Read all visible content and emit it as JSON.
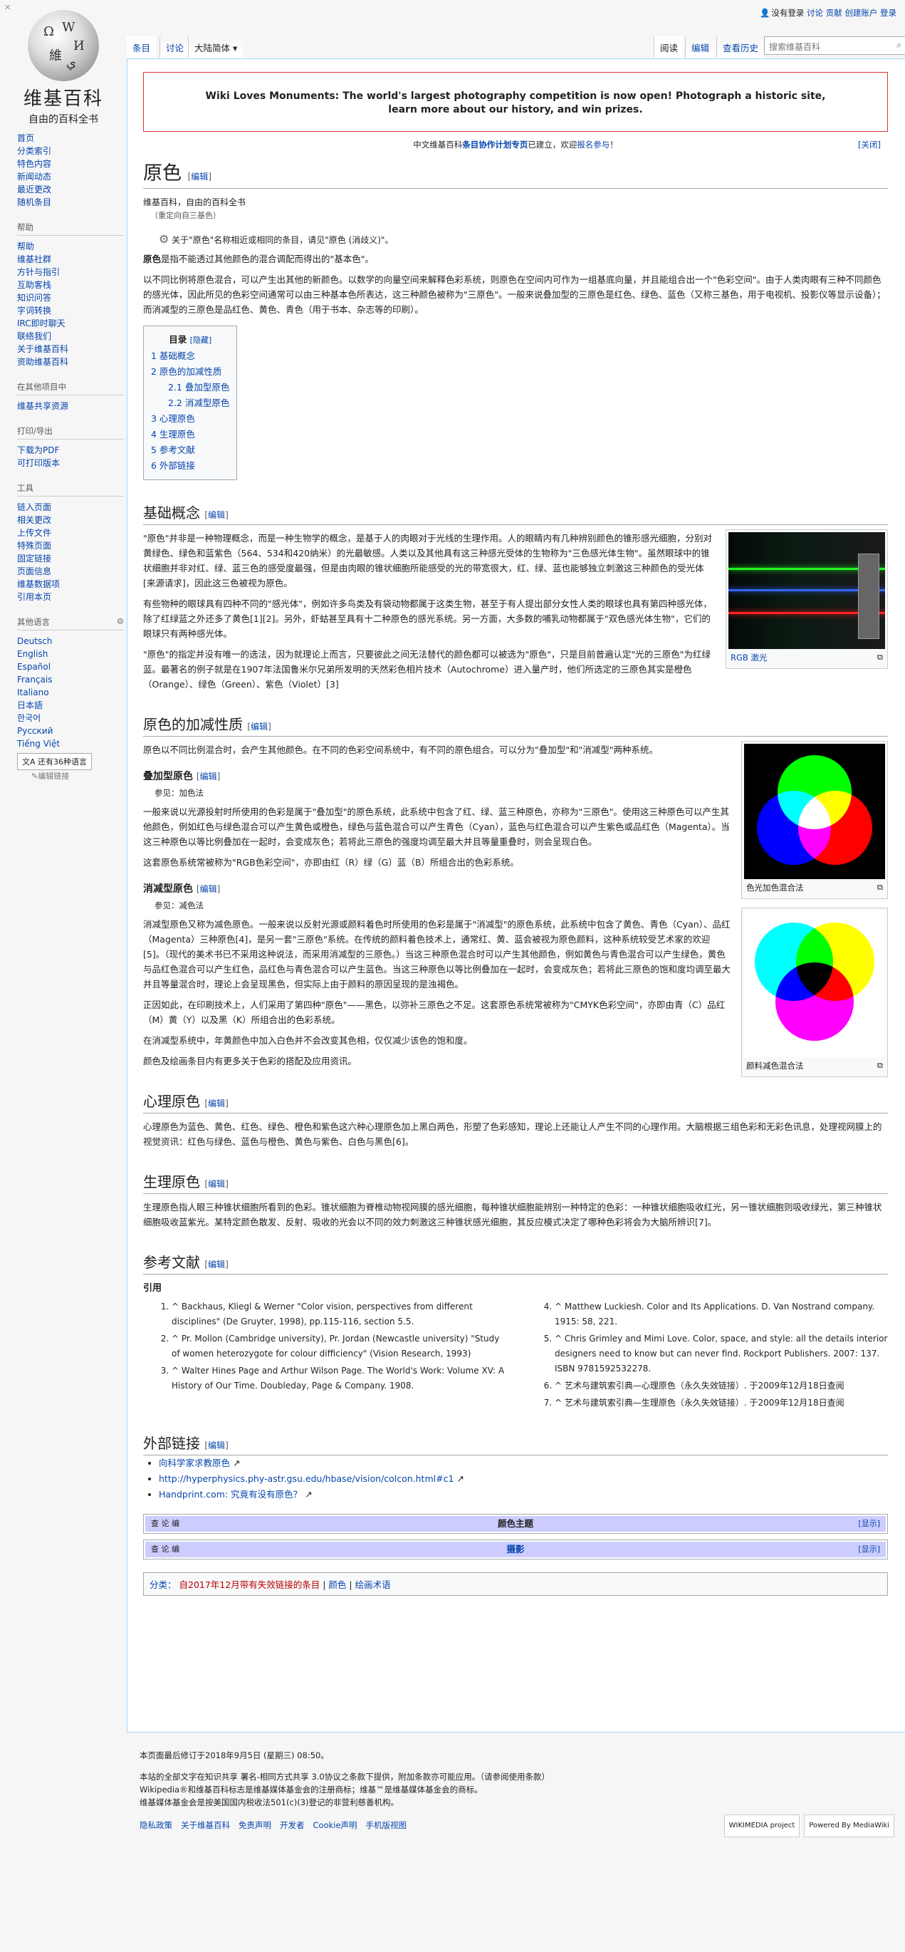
{
  "personal": {
    "notlogged": "没有登录",
    "talk": "讨论",
    "contrib": "贡献",
    "create": "创建账户",
    "login": "登录"
  },
  "logo": {
    "title": "维基百科",
    "subtitle": "自由的百科全书"
  },
  "tabs": {
    "article": "条目",
    "talk": "讨论",
    "variant": "大陆简体",
    "read": "阅读",
    "edit": "编辑",
    "history": "查看历史",
    "search_placeholder": "搜索维基百科"
  },
  "sidebar": {
    "nav": [
      "首页",
      "分类索引",
      "特色内容",
      "新闻动态",
      "最近更改",
      "随机条目"
    ],
    "help_title": "帮助",
    "help": [
      "帮助",
      "维基社群",
      "方针与指引",
      "互助客栈",
      "知识问答",
      "字词转换",
      "IRC即时聊天",
      "联络我们",
      "关于维基百科",
      "资助维基百科"
    ],
    "other_title": "在其他项目中",
    "other": [
      "维基共享资源"
    ],
    "print_title": "打印/导出",
    "print": [
      "下载为PDF",
      "可打印版本"
    ],
    "tools_title": "工具",
    "tools": [
      "链入页面",
      "相关更改",
      "上传文件",
      "特殊页面",
      "固定链接",
      "页面信息",
      "维基数据项",
      "引用本页"
    ],
    "lang_title": "其他语言",
    "langs": [
      "Deutsch",
      "English",
      "Español",
      "Français",
      "Italiano",
      "日本語",
      "한국어",
      "Русский",
      "Tiếng Việt"
    ],
    "lang_btn": "还有36种语言",
    "edit_links": "编辑链接"
  },
  "banner": {
    "line1": "Wiki Loves Monuments: The world's largest photography competition is now open! Photograph a historic site,",
    "line2": "learn more about our history, and win prizes."
  },
  "cn_note": {
    "pre": "中文维基百科",
    "link1": "条目协作计划专页",
    "mid": "已建立，欢迎",
    "link2": "报名参与",
    "end": "！",
    "close": "[关闭]"
  },
  "title": "原色",
  "edit": "编辑",
  "siteSub": "维基百科，自由的百科全书",
  "redirect": "（重定向自三基色）",
  "hatnote": "关于\"原色\"名称相近或相同的条目，请见\"原色 (消歧义)\"。",
  "lead_bold": "原色",
  "lead1": "是指不能透过其他颜色的混合调配而得出的\"基本色\"。",
  "lead2": "以不同比例将原色混合，可以产生出其他的新颜色。以数学的向量空间来解释色彩系统，则原色在空间内可作为一组基底向量，并且能组合出一个\"色彩空间\"。由于人类肉眼有三种不同颜色的感光体，因此所见的色彩空间通常可以由三种基本色所表达，这三种颜色被称为\"三原色\"。一般来说叠加型的三原色是红色、绿色、蓝色（又称三基色，用于电视机、投影仪等显示设备）；而消减型的三原色是品红色、黄色、青色（用于书本、杂志等的印刷）。",
  "toc": {
    "title": "目录",
    "hide": "[隐藏]",
    "items": [
      "1 基础概念",
      "2 原色的加减性质",
      "2.1 叠加型原色",
      "2.2 消减型原色",
      "3 心理原色",
      "4 生理原色",
      "5 参考文献",
      "6 外部链接"
    ]
  },
  "s1": {
    "title": "基础概念",
    "p1": "\"原色\"并非是一种物理概念，而是一种生物学的概念，是基于人的肉眼对于光线的生理作用。人的眼睛内有几种辨别颜色的锥形感光细胞，分别对黄绿色、绿色和蓝紫色（564、534和420纳米）的光最敏感。人类以及其他具有这三种感光受体的生物称为\"三色感光体生物\"。虽然眼球中的锥状细胞并非对红、绿、蓝三色的感受度最强，但是由肉眼的锥状细胞所能感受的光的带宽很大，红、绿、蓝也能够独立刺激这三种颜色的受光体[来源请求]，因此这三色被视为原色。",
    "p2": "有些物种的眼球具有四种不同的\"感光体\"，例如许多鸟类及有袋动物都属于这类生物，甚至于有人提出部分女性人类的眼球也具有第四种感光体，除了红绿蓝之外还多了黄色[1][2]。另外，虾蛄甚至具有十二种原色的感光系统。另一方面，大多数的哺乳动物都属于\"双色感光体生物\"，它们的眼球只有两种感光体。",
    "p3": "\"原色\"的指定并没有唯一的选法，因为就理论上而言，只要彼此之间无法替代的颜色都可以被选为\"原色\"，只是目前普遍认定\"光的三原色\"为红绿蓝。最著名的例子就是在1907年法国鲁米尔兄弟所发明的天然彩色相片技术（Autochrome）进入量产时，他们所选定的三原色其实是橙色（Orange）、绿色（Green）、紫色（Violet）[3]",
    "cap": "RGB 激光"
  },
  "s2": {
    "title": "原色的加减性质",
    "p1": "原色以不同比例混合时，会产生其他颜色。在不同的色彩空间系统中，有不同的原色组合。可以分为\"叠加型\"和\"消减型\"两种系统。",
    "cap1": "色光加色混合法",
    "cap2": "颜料减色混合法"
  },
  "s21": {
    "title": "叠加型原色",
    "main": "参见：加色法",
    "p1": "一般来说以光源投射时所使用的色彩是属于\"叠加型\"的原色系统，此系统中包含了红、绿、蓝三种原色，亦称为\"三原色\"。使用这三种原色可以产生其他颜色，例如红色与绿色混合可以产生黄色或橙色，绿色与蓝色混合可以产生青色（Cyan），蓝色与红色混合可以产生紫色或品红色（Magenta）。当这三种原色以等比例叠加在一起时，会变成灰色；若将此三原色的强度均调至最大并且等量重叠时，则会呈现白色。",
    "p2": "这套原色系统常被称为\"RGB色彩空间\"，亦即由红（R）绿（G）蓝（B）所组合出的色彩系统。"
  },
  "s22": {
    "title": "消减型原色",
    "main": "参见：减色法",
    "p1": "消减型原色又称为减色原色。一般来说以反射光源或颜料着色时所使用的色彩是属于\"消减型\"的原色系统，此系统中包含了黄色、青色（Cyan）、品红（Magenta）三种原色[4]，是另一套\"三原色\"系统。在传统的颜料着色技术上，通常红、黄、蓝会被视为原色颜料，这种系统较受艺术家的欢迎[5]。（现代的美术书已不采用这种说法，而采用消减型的三原色。）当这三种原色混合时可以产生其他颜色，例如黄色与青色混合可以产生绿色，黄色与品红色混合可以产生红色，品红色与青色混合可以产生蓝色。当这三种原色以等比例叠加在一起时，会变成灰色；若将此三原色的饱和度均调至最大并且等量混合时，理论上会呈现黑色，但实际上由于颜料的原因呈现的是浊褐色。",
    "p2": "正因如此，在印刷技术上，人们采用了第四种\"原色\"——黑色，以弥补三原色之不足。这套原色系统常被称为\"CMYK色彩空间\"，亦即由青（C）品红（M）黄（Y）以及黑（K）所组合出的色彩系统。",
    "p3": "在消减型系统中，年黄颜色中加入白色并不会改变其色相，仅仅减少该色的饱和度。",
    "p4": "颜色及绘画条目内有更多关于色彩的搭配及应用资讯。"
  },
  "s3": {
    "title": "心理原色",
    "p1": "心理原色为蓝色、黄色、红色、绿色、橙色和紫色这六种心理原色加上黑白两色，形塑了色彩感知，理论上还能让人产生不同的心理作用。大脑根据三组色彩和无彩色讯息，处理视网膜上的视觉资讯：红色与绿色、蓝色与橙色、黄色与紫色、白色与黑色[6]。"
  },
  "s4": {
    "title": "生理原色",
    "p1": "生理原色指人眼三种锥状细胞所看到的色彩。锥状细胞为脊椎动物视网膜的感光细胞，每种锥状细胞能辨别一种特定的色彩：一种锥状细胞吸收红光，另一锥状细胞则吸收绿光，第三种锥状细胞吸收蓝紫光。某特定颜色散发、反射、吸收的光会以不同的效力刺激这三种锥状感光细胞，其反应模式决定了哪种色彩将会为大脑所辨识[7]。"
  },
  "s5": {
    "title": "参考文献",
    "sub": "引用",
    "refs": [
      "^ Backhaus, Kliegl & Werner \"Color vision, perspectives from different disciplines\" (De Gruyter, 1998), pp.115-116, section 5.5.",
      "^ Pr. Mollon (Cambridge university), Pr. Jordan (Newcastle university) \"Study of women heterozygote for colour difficiency\" (Vision Research, 1993)",
      "^ Walter Hines Page and Arthur Wilson Page. The World's Work: Volume XV: A History of Our Time. Doubleday, Page & Company. 1908.",
      "^ Matthew Luckiesh. Color and Its Applications. D. Van Nostrand company. 1915: 58, 221.",
      "^ Chris Grimley and Mimi Love. Color, space, and style: all the details interior designers need to know but can never find. Rockport Publishers. 2007: 137. ISBN 9781592532278.",
      "^ 艺术与建筑索引典—心理原色（永久失效链接）. 于2009年12月18日查阅",
      "^ 艺术与建筑索引典—生理原色（永久失效链接）. 于2009年12月18日查阅"
    ]
  },
  "s6": {
    "title": "外部链接",
    "links": [
      "向科学家求教原色",
      "http://hyperphysics.phy-astr.gsu.edu/hbase/vision/colcon.html#c1",
      "Handprint.com: 究竟有没有原色？"
    ]
  },
  "navbox": {
    "vte": "查 论 编",
    "row1": "颜色主题",
    "row2": "摄影",
    "show": "[显示]"
  },
  "cats": {
    "label": "分类：",
    "items": [
      "自2017年12月带有失效链接的条目",
      "颜色",
      "绘画术语"
    ]
  },
  "footer": {
    "modified": "本页面最后修订于2018年9月5日 (星期三) 08:50。",
    "license1": "本站的全部文字在知识共享 署名-相同方式共享 3.0协议之条款下提供，附加条款亦可能应用。（请参阅使用条款）",
    "license2": "Wikipedia®和维基百科标志是维基媒体基金会的注册商标；维基™是维基媒体基金会的商标。",
    "license3": "维基媒体基金会是按美国国内税收法501(c)(3)登记的非营利慈善机构。",
    "links": [
      "隐私政策",
      "关于维基百科",
      "免责声明",
      "开发者",
      "Cookie声明",
      "手机版视图"
    ],
    "badge1": "WIKIMEDIA project",
    "badge2": "Powered By MediaWiki"
  },
  "colors": {
    "link": "#0645ad",
    "navbox": "#ccccff",
    "banner_border": "#dd3333"
  }
}
